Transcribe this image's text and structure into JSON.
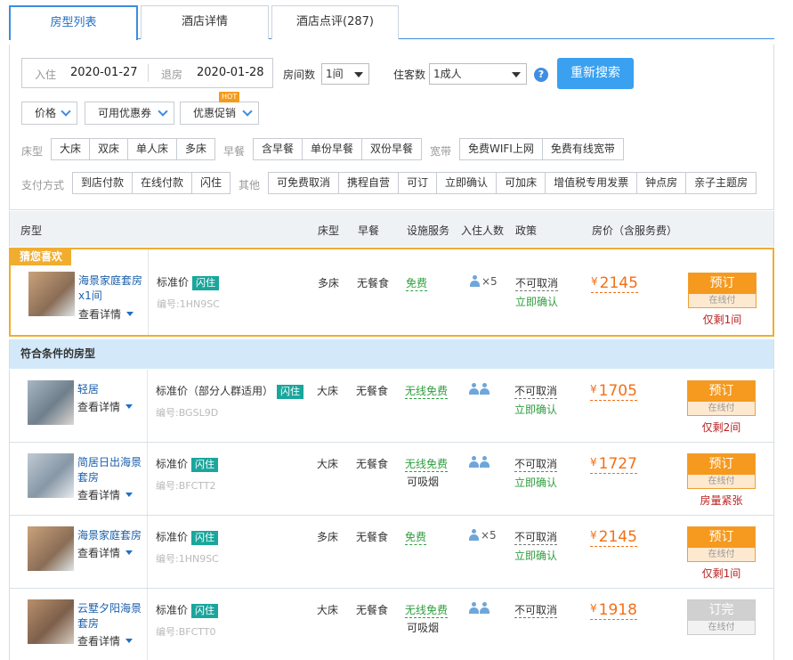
{
  "tabs": [
    "房型列表",
    "酒店详情",
    "酒店点评(287)"
  ],
  "search": {
    "checkin_label": "入住",
    "checkin": "2020-01-27",
    "checkout_label": "退房",
    "checkout": "2020-01-28",
    "rooms_label": "房间数",
    "rooms": "1间",
    "guests_label": "住客数",
    "guests": "1成人",
    "help": "?",
    "button": "重新搜索"
  },
  "dropdowns": [
    "价格",
    "可用优惠券",
    "优惠促销"
  ],
  "hot_badge": "HOT",
  "filters": {
    "bed_label": "床型",
    "bed": [
      "大床",
      "双床",
      "单人床",
      "多床"
    ],
    "breakfast_label": "早餐",
    "breakfast": [
      "含早餐",
      "单份早餐",
      "双份早餐"
    ],
    "broadband_label": "宽带",
    "broadband": [
      "免费WIFI上网",
      "免费有线宽带"
    ],
    "pay_label": "支付方式",
    "pay": [
      "到店付款",
      "在线付款",
      "闪住"
    ],
    "other_label": "其他",
    "other": [
      "可免费取消",
      "携程自营",
      "可订",
      "立即确认",
      "可加床",
      "增值税专用发票",
      "钟点房",
      "亲子主题房"
    ]
  },
  "columns": [
    "房型",
    "床型",
    "早餐",
    "设施服务",
    "入住人数",
    "政策",
    "房价（含服务费）"
  ],
  "guess_label": "猜您喜欢",
  "section_label": "符合条件的房型",
  "detail_label": "查看详情",
  "flash_label": "闪住",
  "rooms": [
    {
      "name": "海景家庭套房x1间",
      "std": "标准价",
      "code": "编号:1HN9SC",
      "bed": "多床",
      "breakfast": "无餐食",
      "facility": "免费",
      "facility2": "",
      "persons": "×5",
      "cancel": "不可取消",
      "confirm": "立即确认",
      "currency": "¥",
      "price": "2145",
      "book": "预订",
      "pay": "在线付",
      "remain": "仅剩1间"
    },
    {
      "name": "轻居",
      "std": "标准价（部分人群适用）",
      "code": "编号:BGSL9D",
      "bed": "大床",
      "breakfast": "无餐食",
      "facility": "无线免费",
      "facility2": "",
      "persons": "",
      "cancel": "不可取消",
      "confirm": "立即确认",
      "currency": "¥",
      "price": "1705",
      "book": "预订",
      "pay": "在线付",
      "remain": "仅剩2间"
    },
    {
      "name": "简居日出海景套房",
      "std": "标准价",
      "code": "编号:BFCTT2",
      "bed": "大床",
      "breakfast": "无餐食",
      "facility": "无线免费",
      "facility2": "可吸烟",
      "persons": "",
      "cancel": "不可取消",
      "confirm": "立即确认",
      "currency": "¥",
      "price": "1727",
      "book": "预订",
      "pay": "在线付",
      "remain": "房量紧张"
    },
    {
      "name": "海景家庭套房",
      "std": "标准价",
      "code": "编号:1HN9SC",
      "bed": "多床",
      "breakfast": "无餐食",
      "facility": "免费",
      "facility2": "",
      "persons": "×5",
      "cancel": "不可取消",
      "confirm": "立即确认",
      "currency": "¥",
      "price": "2145",
      "book": "预订",
      "pay": "在线付",
      "remain": "仅剩1间"
    },
    {
      "name": "云墅夕阳海景套房",
      "std": "标准价",
      "code": "编号:BFCTT0",
      "bed": "大床",
      "breakfast": "无餐食",
      "facility": "无线免费",
      "facility2": "可吸烟",
      "persons": "",
      "cancel": "不可取消",
      "confirm": "",
      "currency": "¥",
      "price": "1918",
      "book": "订完",
      "pay": "在线付",
      "remain": ""
    }
  ]
}
